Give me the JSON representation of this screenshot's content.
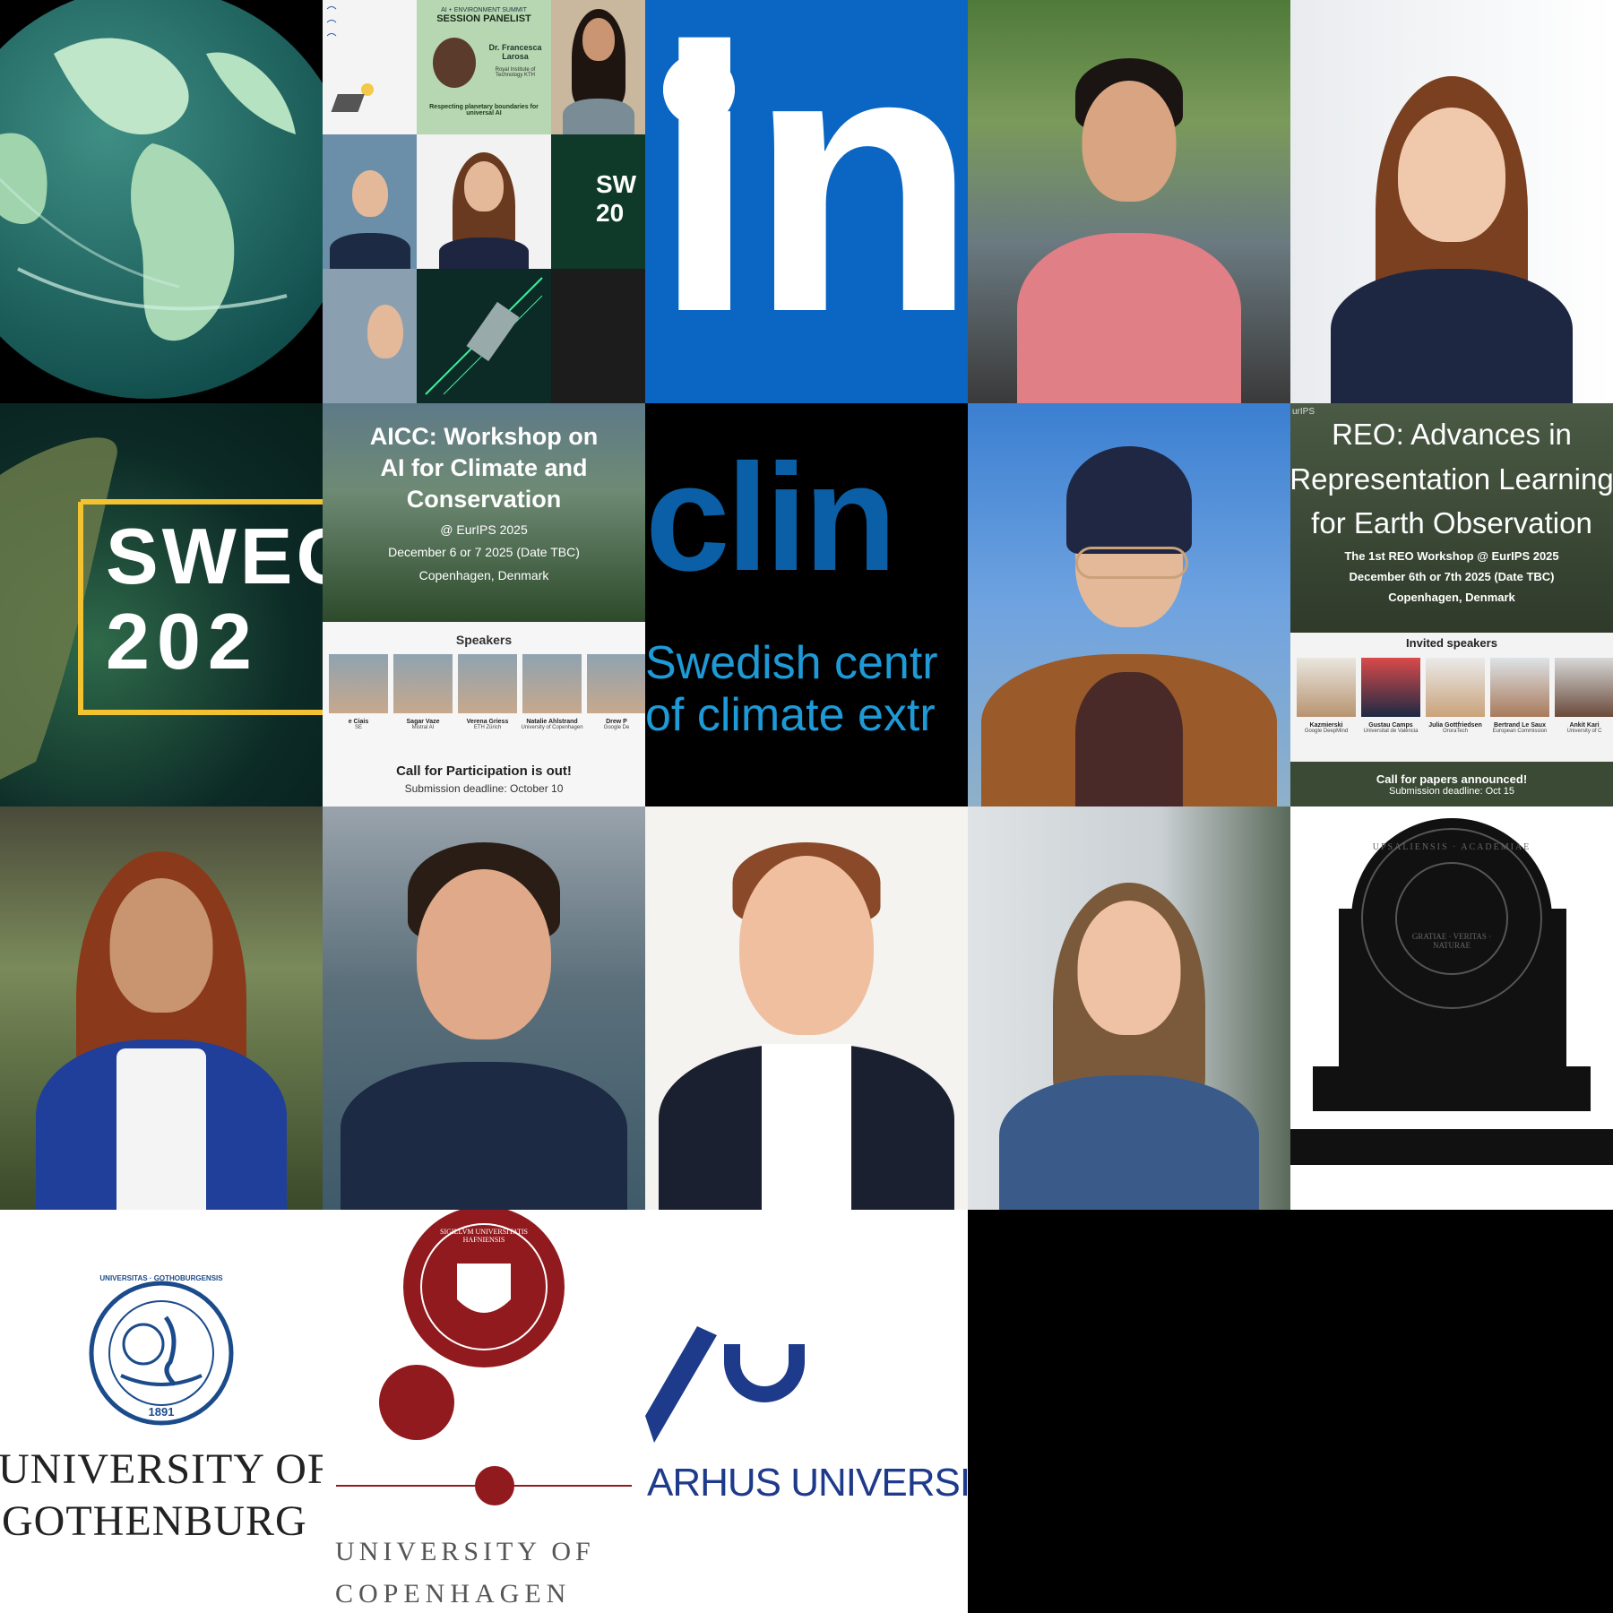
{
  "tiles": {
    "summit": {
      "header": "AI + ENVIRONMENT SUMMIT",
      "role": "SESSION PANELIST",
      "name": "Dr. Francesca Larosa",
      "affiliation": "Royal Institute of Technology KTH",
      "topic": "Respecting planetary boundaries for universal AI",
      "sw": "SW",
      "sw_year": "20"
    },
    "linkedin": {
      "logo": "in",
      "color": "#0A66C2"
    },
    "swec": {
      "line1": "SWEC",
      "line2": "202"
    },
    "aicc": {
      "title": "AICC: Workshop on AI for Climate and Conservation",
      "venue": "@ EurIPS 2025",
      "date": "December 6 or 7 2025 (Date TBC)",
      "location": "Copenhagen, Denmark",
      "speakers_heading": "Speakers",
      "speakers": [
        {
          "name": "e Ciais",
          "aff": "SE"
        },
        {
          "name": "Sagar Vaze",
          "aff": "Mistral AI"
        },
        {
          "name": "Verena Griess",
          "aff": "ETH Zürich"
        },
        {
          "name": "Natalie Ahlstrand",
          "aff": "University of Copenhagen"
        },
        {
          "name": "Drew P",
          "aff": "Google De"
        }
      ],
      "cta": "Call for Participation is out!",
      "deadline": "Submission deadline: October 10"
    },
    "climes": {
      "word": "clin",
      "line1": "Swedish centr",
      "line2": "of climate extr"
    },
    "reo": {
      "corner": "urIPS",
      "title": "REO: Advances in Representation Learning for Earth Observation",
      "line1": "The 1st REO Workshop @ EurIPS 2025",
      "line2": "December 6th or 7th 2025 (Date TBC)",
      "line3": "Copenhagen, Denmark",
      "speakers_heading": "Invited speakers",
      "speakers": [
        {
          "name": "Kazmierski",
          "aff": "Google DeepMind"
        },
        {
          "name": "Gustau Camps",
          "aff": "Universitat de València"
        },
        {
          "name": "Julia Gottfriedsen",
          "aff": "OroraTech"
        },
        {
          "name": "Bertrand Le Saux",
          "aff": "European Commission"
        },
        {
          "name": "Ankit Kari",
          "aff": "University of C"
        }
      ],
      "cta": "Call for papers announced!",
      "deadline": "Submission deadline: Oct 15"
    },
    "uppsala": {
      "seal_outer": "UPSALIENSIS · ACADEMIAE",
      "seal_inner": "GRATIAE · VERITAS · NATURAE"
    },
    "gothenburg": {
      "seal_text": "UNIVERSITAS · GOTHOBURGENSIS",
      "seal_year": "1891",
      "line1": "UNIVERSITY OF",
      "line2": "GOTHENBURG"
    },
    "copenhagen": {
      "seal_text": "SIGILLVM UNIVERSITATIS HAFNIENSIS",
      "line1": "UNIVERSITY OF",
      "line2": "COPENHAGEN"
    },
    "aarhus": {
      "name": "ARHUS UNIVERSIT"
    }
  }
}
